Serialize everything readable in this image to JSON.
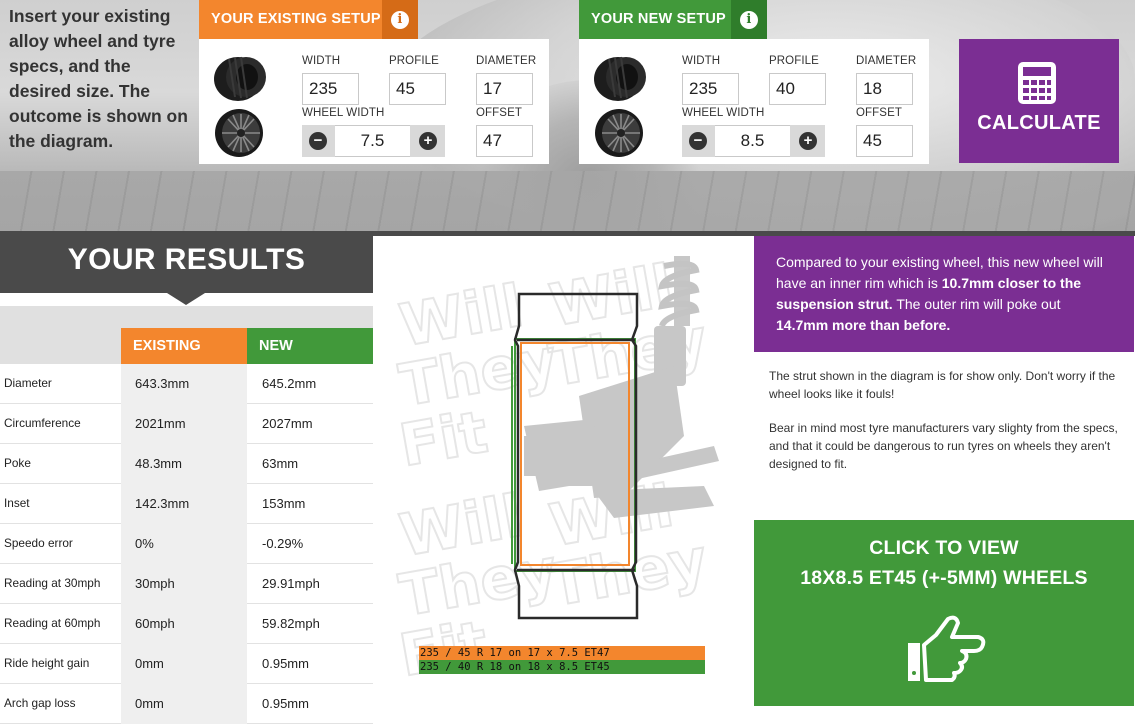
{
  "intro": {
    "text": "Insert your existing alloy wheel and tyre specs, and the desired size. The outcome is shown on the diagram."
  },
  "existing_setup": {
    "title": "YOUR EXISTING SETUP",
    "info_icon": "info-icon",
    "labels": {
      "width": "WIDTH",
      "profile": "PROFILE",
      "diameter": "DIAMETER",
      "wheel_width": "WHEEL WIDTH",
      "offset": "OFFSET"
    },
    "values": {
      "width": "235",
      "profile": "45",
      "diameter": "17",
      "wheel_width": "7.5",
      "offset": "47"
    }
  },
  "new_setup": {
    "title": "YOUR NEW SETUP",
    "info_icon": "info-icon",
    "labels": {
      "width": "WIDTH",
      "profile": "PROFILE",
      "diameter": "DIAMETER",
      "wheel_width": "WHEEL WIDTH",
      "offset": "OFFSET"
    },
    "values": {
      "width": "235",
      "profile": "40",
      "diameter": "18",
      "wheel_width": "8.5",
      "offset": "45"
    }
  },
  "calculate": {
    "label": "CALCULATE",
    "icon": "calculator-icon"
  },
  "results": {
    "title": "YOUR RESULTS",
    "col_existing": "EXISTING",
    "col_new": "NEW",
    "rows": [
      {
        "label": "Diameter",
        "existing": "643.3mm",
        "new": "645.2mm"
      },
      {
        "label": "Circumference",
        "existing": "2021mm",
        "new": "2027mm"
      },
      {
        "label": "Poke",
        "existing": "48.3mm",
        "new": "63mm"
      },
      {
        "label": "Inset",
        "existing": "142.3mm",
        "new": "153mm"
      },
      {
        "label": "Speedo error",
        "existing": "0%",
        "new": "-0.29%"
      },
      {
        "label": "Reading at 30mph",
        "existing": "30mph",
        "new": "29.91mph"
      },
      {
        "label": "Reading at 60mph",
        "existing": "60mph",
        "new": "59.82mph"
      },
      {
        "label": "Ride height gain",
        "existing": "0mm",
        "new": "0.95mm"
      },
      {
        "label": "Arch gap loss",
        "existing": "0mm",
        "new": "0.95mm"
      }
    ]
  },
  "diagram": {
    "watermark": "Will They Fit .com",
    "legend_existing": "235 / 45 R 17 on 17 x 7.5 ET47",
    "legend_new": "235 / 40 R 18 on 18 x 8.5 ET45"
  },
  "comparison": {
    "p1": "Compared to your existing wheel, this new wheel will have an inner rim which is ",
    "b1": "10.7mm closer to the suspension strut.",
    "p2": " The outer rim will poke out ",
    "b2": "14.7mm more than before."
  },
  "notes": {
    "note1": "The strut shown in the diagram is for show only. Don't worry if the wheel looks like it fouls!",
    "note2": "Bear in mind most tyre manufacturers vary slighty from the specs, and that it could be dangerous to run tyres on wheels they aren't designed to fit."
  },
  "view_wheels": {
    "line1": "CLICK TO VIEW",
    "line2": "18X8.5 ET45 (+-5MM) WHEELS",
    "icon": "pointing-hand-icon"
  },
  "colors": {
    "orange": "#f3862d",
    "green": "#41993a",
    "purple": "#7b2e93",
    "dark": "#4a4a4a"
  }
}
